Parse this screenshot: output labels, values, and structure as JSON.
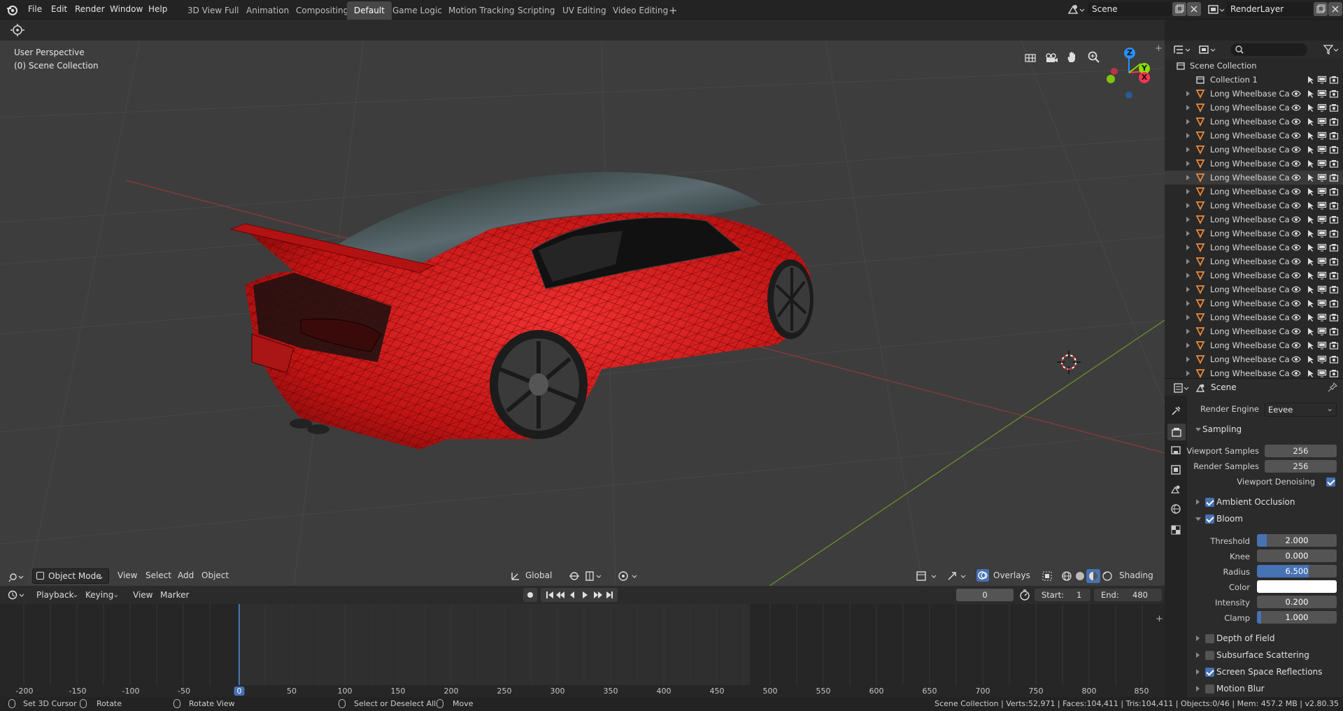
{
  "topbar": {
    "menus": [
      "File",
      "Edit",
      "Render",
      "Window",
      "Help"
    ],
    "workspaces": [
      "3D View Full",
      "Animation",
      "Compositing",
      "Default",
      "Game Logic",
      "Motion Tracking",
      "Scripting",
      "UV Editing",
      "Video Editing"
    ],
    "active_workspace": "Default",
    "add_tab": "+",
    "scene_name": "Scene",
    "render_layer": "RenderLayer"
  },
  "viewport": {
    "perspective_label": "User Perspective",
    "collection_label": "(0) Scene Collection",
    "gizmo": {
      "x": "X",
      "y": "Y",
      "z": "Z"
    },
    "header": {
      "mode": "Object Mode",
      "menus": [
        "View",
        "Select",
        "Add",
        "Object"
      ],
      "transform_orientation": "Global",
      "overlays": "Overlays",
      "shading": "Shading"
    }
  },
  "timeline": {
    "menus": [
      "Playback",
      "Keying",
      "View",
      "Marker"
    ],
    "current_frame": "0",
    "start_label": "Start:",
    "start": "1",
    "end_label": "End:",
    "end": "480",
    "ruler": [
      "-200",
      "-150",
      "-100",
      "-50",
      "0",
      "50",
      "100",
      "150",
      "200",
      "250",
      "300",
      "350",
      "400",
      "450",
      "500",
      "550",
      "600",
      "650",
      "700",
      "750",
      "800",
      "850"
    ]
  },
  "statusbar": {
    "left": [
      "Set 3D Cursor",
      "Rotate",
      "Rotate View",
      "Select or Deselect All",
      "Move"
    ],
    "stats": "Scene Collection | Verts:52,971 | Faces:104,411 | Tris:104,411 | Objects:0/46 | Mem: 457.2 MB | v2.80.35"
  },
  "outliner": {
    "root": "Scene Collection",
    "collection": "Collection 1",
    "object_label": "Long Wheelbase Car",
    "object_count_visible": 21,
    "selected_index": 6
  },
  "properties": {
    "context": "Scene",
    "render_engine_label": "Render Engine",
    "render_engine": "Eevee",
    "sampling": {
      "title": "Sampling",
      "viewport_samples_label": "Viewport Samples",
      "viewport_samples": "256",
      "render_samples_label": "Render Samples",
      "render_samples": "256",
      "viewport_denoising_label": "Viewport Denoising"
    },
    "ambient_occlusion": "Ambient Occlusion",
    "bloom": {
      "title": "Bloom",
      "threshold_label": "Threshold",
      "threshold": "2.000",
      "knee_label": "Knee",
      "knee": "0.000",
      "radius_label": "Radius",
      "radius": "6.500",
      "color_label": "Color",
      "intensity_label": "Intensity",
      "intensity": "0.200",
      "clamp_label": "Clamp",
      "clamp": "1.000"
    },
    "depth_of_field": "Depth of Field",
    "subsurface_scattering": "Subsurface Scattering",
    "screen_space_reflections": "Screen Space Reflections",
    "motion_blur": "Motion Blur"
  },
  "colors": {
    "accent": "#4772b3",
    "car_body": "#d81e1e",
    "x_axis": "#ff3352",
    "y_axis": "#8bdc00",
    "z_axis": "#2890ff",
    "object_icon": "#e7893c"
  }
}
